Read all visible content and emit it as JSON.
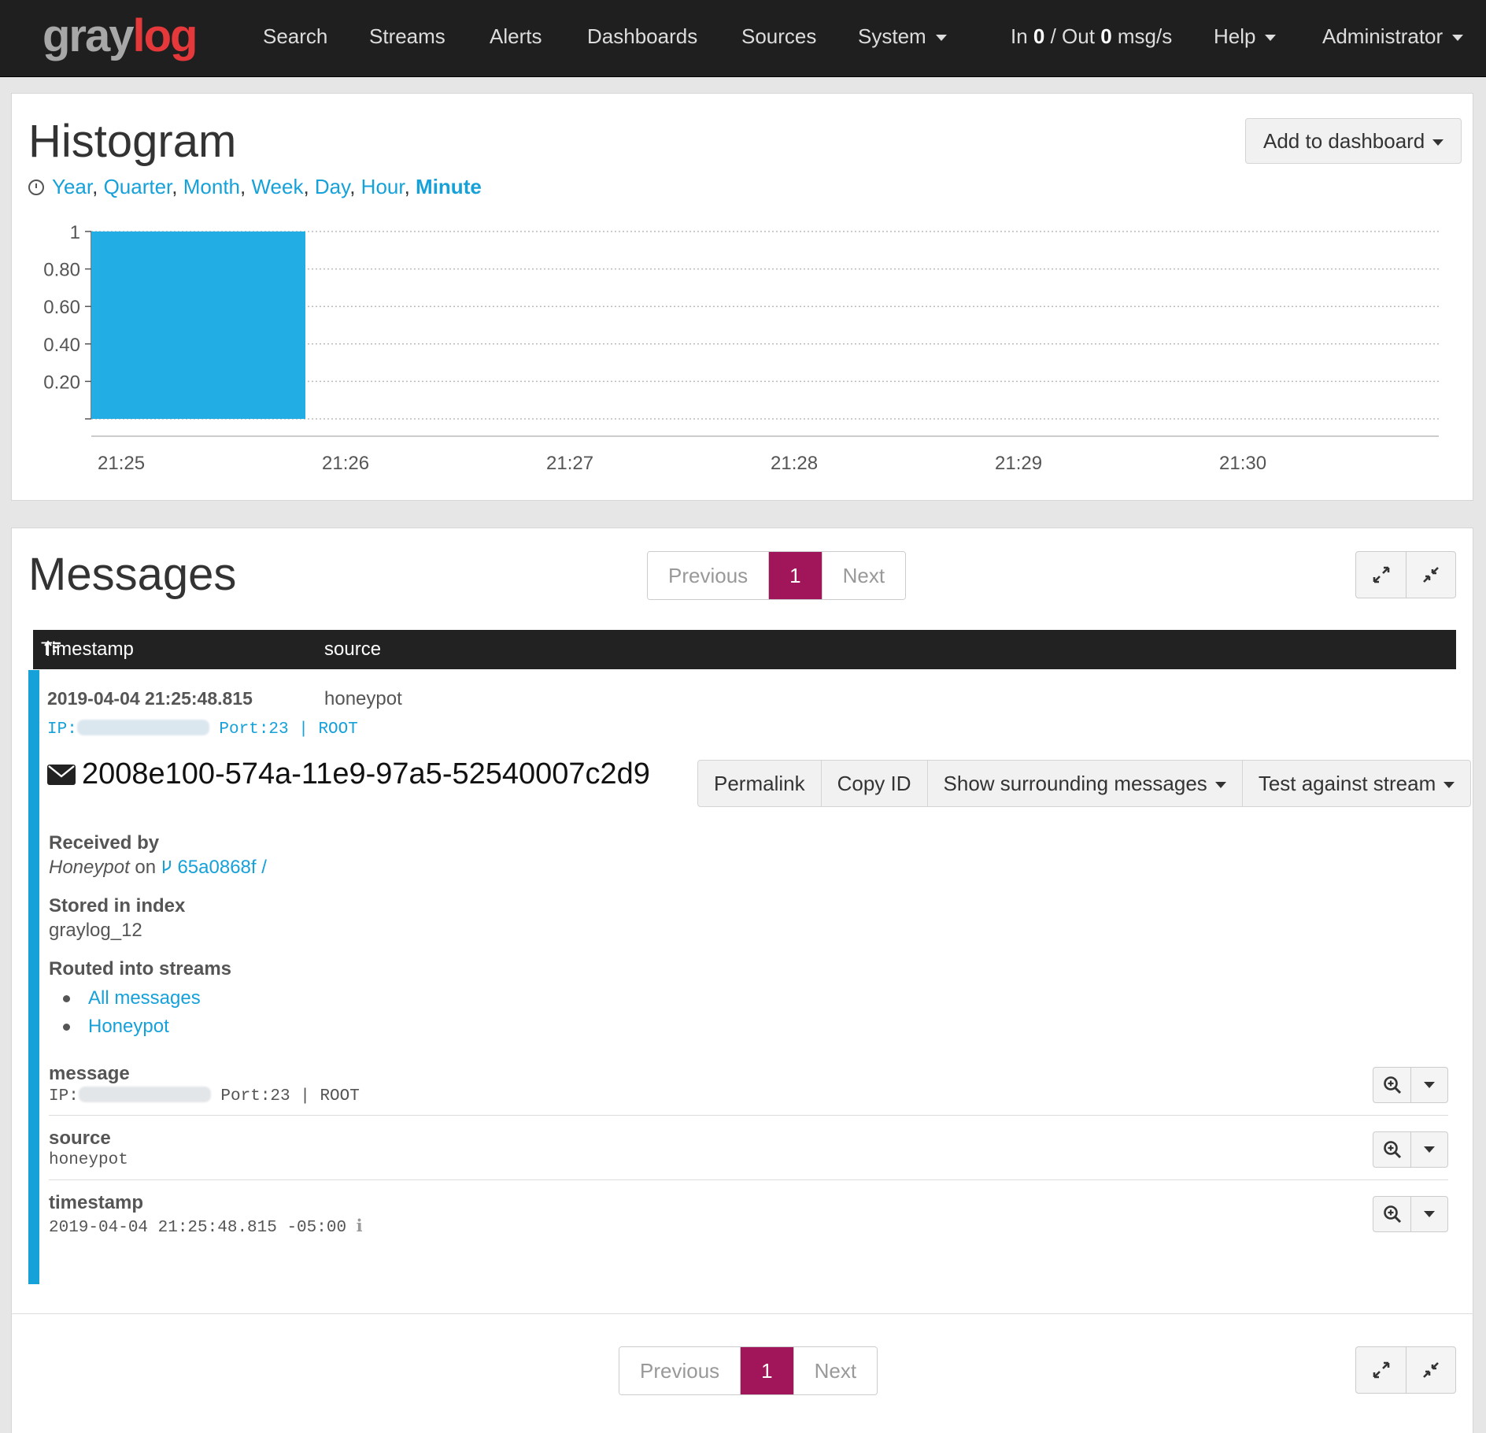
{
  "nav": {
    "logo_gray": "gray",
    "logo_red": "log",
    "items": [
      "Search",
      "Streams",
      "Alerts",
      "Dashboards",
      "Sources",
      "System"
    ],
    "throughput": {
      "prefix": "In ",
      "in": "0",
      "mid": " / Out ",
      "out": "0",
      "suffix": " msg/s"
    },
    "help": "Help",
    "user": "Administrator"
  },
  "histogram": {
    "title": "Histogram",
    "add_to_dashboard": "Add to dashboard",
    "resolutions": [
      "Year",
      "Quarter",
      "Month",
      "Week",
      "Day",
      "Hour",
      "Minute"
    ],
    "active_resolution": "Minute"
  },
  "chart_data": {
    "type": "bar",
    "title": "",
    "xlabel": "",
    "ylabel": "",
    "categories": [
      "21:25",
      "21:26",
      "21:27",
      "21:28",
      "21:29",
      "21:30"
    ],
    "values": [
      1,
      0,
      0,
      0,
      0,
      0
    ],
    "y_ticks": [
      "1",
      "0.80",
      "0.60",
      "0.40",
      "0.20"
    ],
    "ylim": [
      0,
      1
    ],
    "grid": true,
    "color": "#22aee5"
  },
  "messages": {
    "title": "Messages",
    "pager": {
      "previous": "Previous",
      "page": "1",
      "next": "Next"
    },
    "columns": {
      "timestamp": "Timestamp",
      "source": "source"
    },
    "row": {
      "timestamp": "2019-04-04 21:25:48.815",
      "source": "honeypot",
      "summary_prefix": "IP:",
      "summary_suffix": "Port:23 | ROOT",
      "id": "2008e100-574a-11e9-97a5-52540007c2d9"
    },
    "actions": {
      "permalink": "Permalink",
      "copy_id": "Copy ID",
      "surrounding": "Show surrounding messages",
      "test_stream": "Test against stream"
    },
    "details": {
      "received_by_label": "Received by",
      "received_input": "Honeypot",
      "received_on": " on ",
      "node_id": "65a0868f /",
      "stored_label": "Stored in index",
      "index": "graylog_12",
      "routed_label": "Routed into streams",
      "streams": [
        "All messages",
        "Honeypot"
      ]
    },
    "fields": [
      {
        "name": "message",
        "prefix": "IP:",
        "suffix": "Port:23 | ROOT"
      },
      {
        "name": "source",
        "value": "honeypot"
      },
      {
        "name": "timestamp",
        "value": "2019-04-04 21:25:48.815 -05:00"
      }
    ],
    "bottom_pager": {
      "previous": "Previous",
      "page": "1",
      "next": "Next"
    }
  },
  "colors": {
    "accent": "#16a1d9",
    "pager_active": "#a1165a",
    "nav_bg": "#1f1f1f"
  }
}
